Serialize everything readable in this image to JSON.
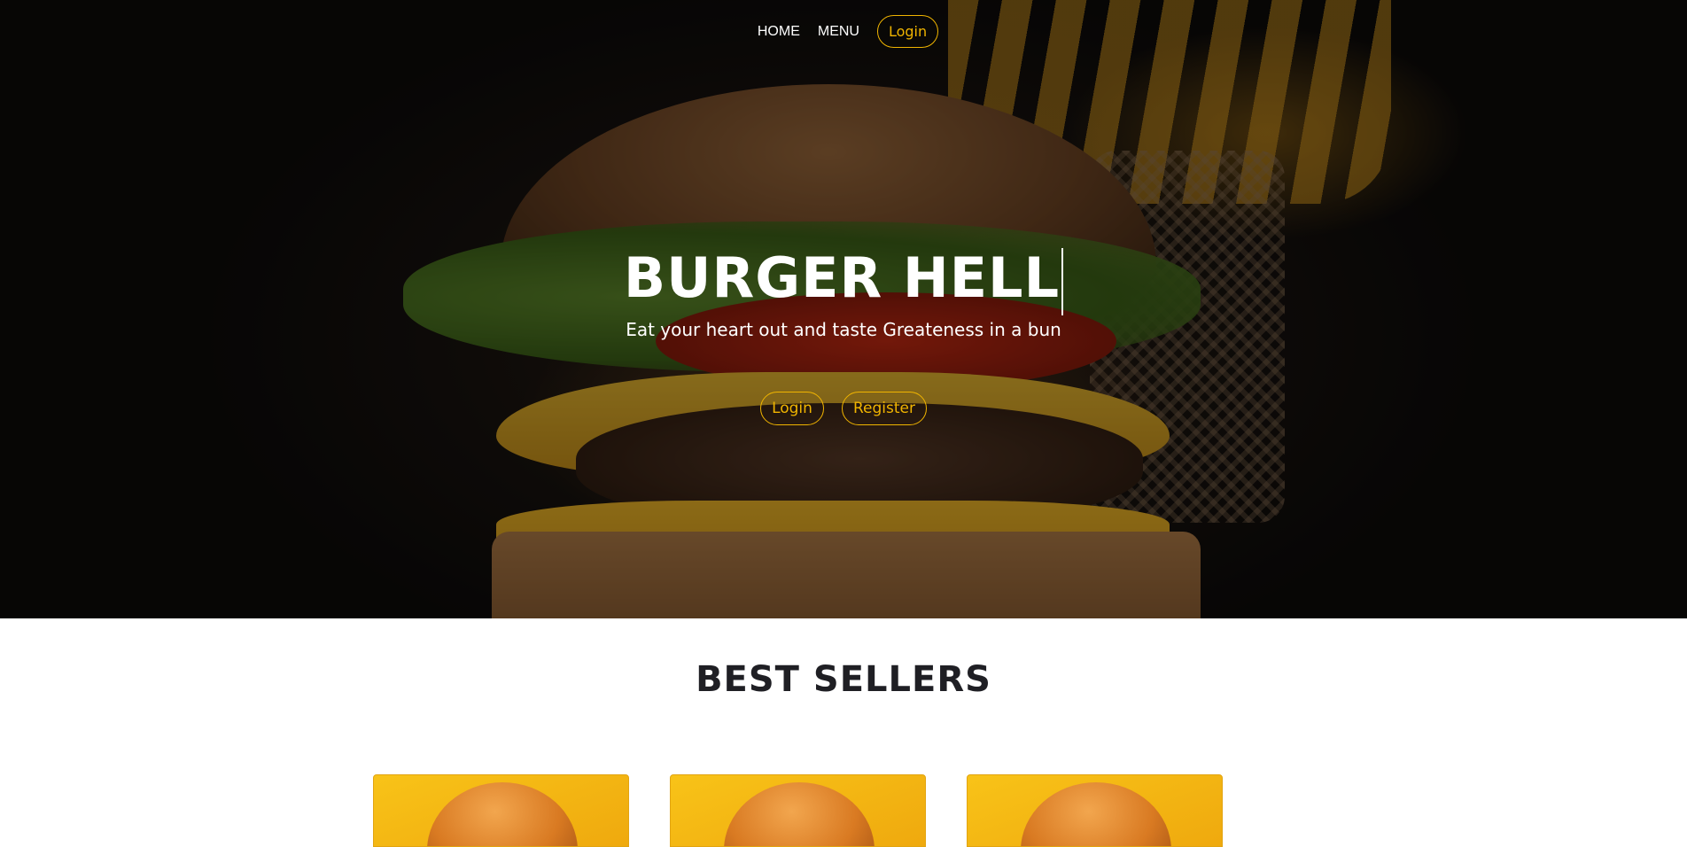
{
  "nav": {
    "home_label": "HOME",
    "menu_label": "MENU",
    "login_label": "Login"
  },
  "hero": {
    "title": "BURGER HELL",
    "subtitle": "Eat your heart out and taste Greateness in a bun",
    "login_label": "Login",
    "register_label": "Register"
  },
  "best_sellers": {
    "title": "BEST SELLERS",
    "cards": [
      {
        "image": "burger-image"
      },
      {
        "image": "burger-image"
      },
      {
        "image": "burger-image"
      }
    ]
  },
  "colors": {
    "accent": "#f0b400",
    "heading_dark": "#1f1f24",
    "nav_text": "#ffffff"
  }
}
